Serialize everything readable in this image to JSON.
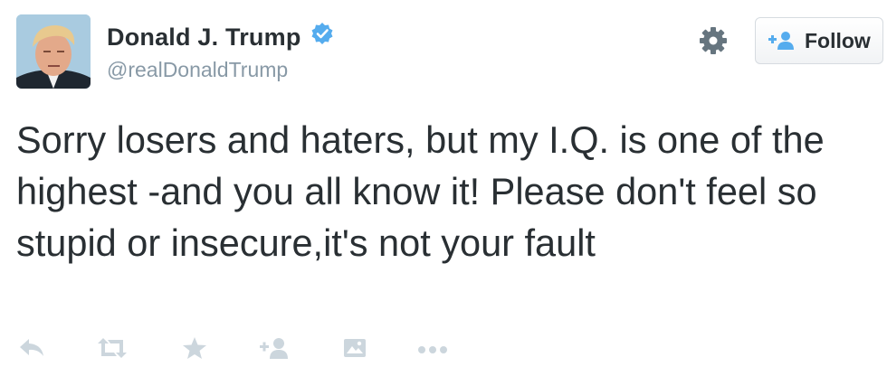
{
  "user": {
    "display_name": "Donald J. Trump",
    "handle": "@realDonaldTrump",
    "verified": true
  },
  "follow_button": {
    "label": "Follow"
  },
  "tweet": {
    "text": "Sorry losers and haters, but my I.Q. is one of the highest -and you all know it! Please don't feel so stupid or insecure,it's not your fault"
  },
  "icons": {
    "settings": "gear-icon",
    "follow": "add-user-icon",
    "actions": [
      "reply-icon",
      "retweet-icon",
      "favorite-star-icon",
      "add-user-icon",
      "photo-icon",
      "more-icon"
    ]
  },
  "colors": {
    "text": "#292f33",
    "muted": "#8899a6",
    "verified_blue": "#55acee",
    "action_gray": "#ccd6dd"
  }
}
